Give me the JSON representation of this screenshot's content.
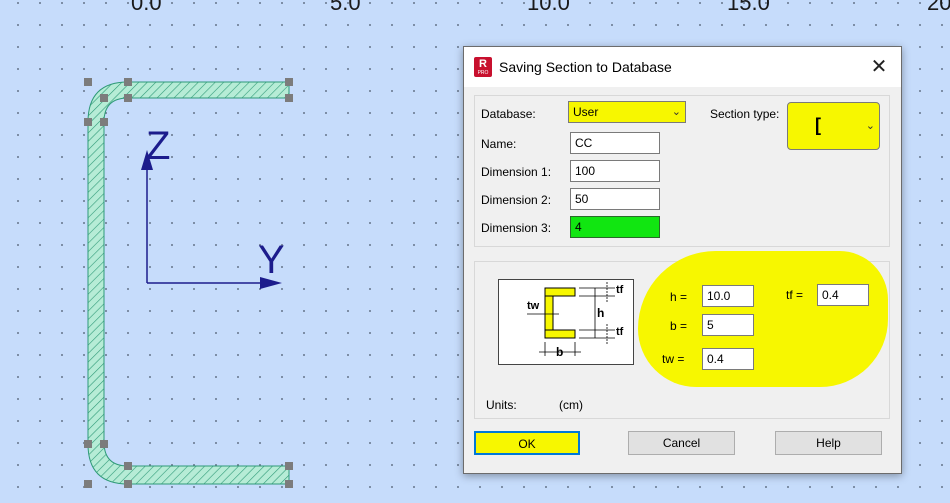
{
  "ruler": {
    "labels": [
      "0.0",
      "5.0",
      "10.0",
      "15.0",
      "20"
    ]
  },
  "axes": {
    "z_label": "Z",
    "y_label": "Y"
  },
  "dialog": {
    "title": "Saving Section to Database",
    "logo_letter": "R",
    "logo_sub": "PRO",
    "close_glyph": "✕",
    "database_label": "Database:",
    "database_value": "User",
    "section_type_label": "Section type:",
    "section_type_value": "[",
    "name_label": "Name:",
    "name_value": "CC",
    "dim1_label": "Dimension 1:",
    "dim1_value": "100",
    "dim2_label": "Dimension 2:",
    "dim2_value": "50",
    "dim3_label": "Dimension 3:",
    "dim3_value": "4",
    "diagram": {
      "tf_top": "tf",
      "tf_bottom": "tf",
      "h": "h",
      "tw": "tw",
      "b": "b"
    },
    "h_label": "h =",
    "h_value": "10.0",
    "b_label": "b =",
    "b_value": "5",
    "tw_label": "tw =",
    "tw_value": "0.4",
    "tf_label": "tf =",
    "tf_value": "0.4",
    "units_label": "Units:",
    "units_value": "(cm)",
    "ok_label": "OK",
    "cancel_label": "Cancel",
    "help_label": "Help"
  },
  "colors": {
    "highlight": "#f7f700",
    "canvas_bg": "#c6dcfb",
    "section_fill": "#b6ecd6",
    "axis_color": "#1c1c8c"
  }
}
